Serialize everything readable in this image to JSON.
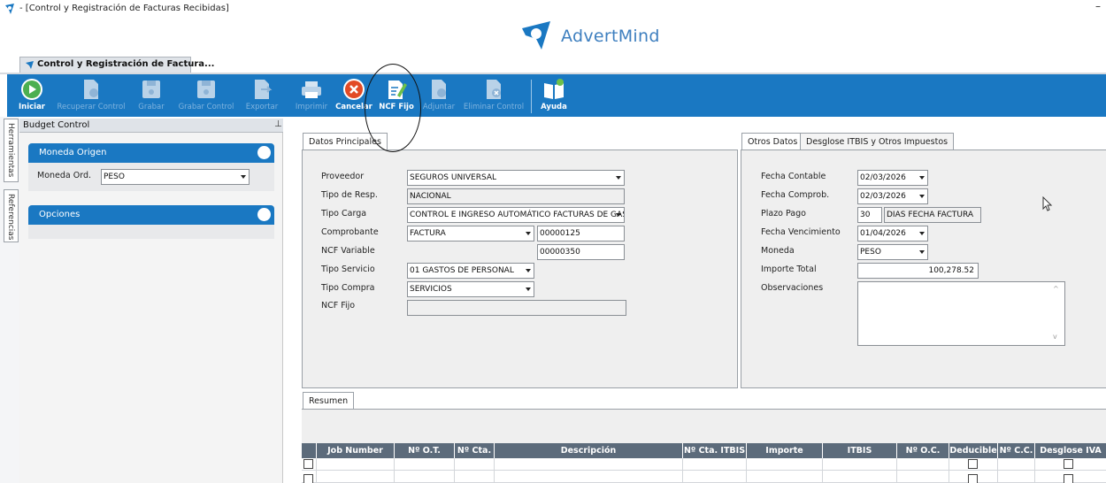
{
  "window": {
    "title": "- [Control y Registración de Facturas Recibidas]",
    "minimize_glyph": "–"
  },
  "brand": {
    "name": "AdvertMind",
    "color": "#3e7fbf"
  },
  "doc_tab": {
    "label": "Control y Registración de Factura..."
  },
  "toolbar": {
    "iniciar": "Iniciar",
    "recuperar": "Recuperar Control",
    "grabar": "Grabar",
    "grabar_control": "Grabar Control",
    "exportar": "Exportar",
    "imprimir": "Imprimir",
    "cancelar": "Cancelar",
    "ncf_fijo": "NCF Fijo",
    "adjuntar": "Adjuntar",
    "eliminar": "Eliminar Control",
    "ayuda": "Ayuda",
    "color": "#1a78c2"
  },
  "vertical_tabs": {
    "herramientas": "Herramientas",
    "referencias": "Referencias"
  },
  "budget": {
    "title": "Budget Control",
    "pin": "ᵖ",
    "moneda_origen": {
      "title": "Moneda Origen",
      "label": "Moneda Ord.",
      "value": "PESO"
    },
    "opciones": {
      "title": "Opciones"
    }
  },
  "datos_principales": {
    "tab": "Datos Principales",
    "proveedor": {
      "label": "Proveedor",
      "value": "SEGUROS UNIVERSAL"
    },
    "tipo_resp": {
      "label": "Tipo de Resp.",
      "value": "NACIONAL"
    },
    "tipo_carga": {
      "label": "Tipo Carga",
      "value": "CONTROL E INGRESO AUTOMÁTICO FACTURAS DE GAS"
    },
    "comprobante": {
      "label": "Comprobante",
      "value": "FACTURA",
      "number": "00000125"
    },
    "ncf_variable": {
      "label": "NCF Variable",
      "value": "00000350"
    },
    "tipo_servicio": {
      "label": "Tipo Servicio",
      "value": "01 GASTOS DE PERSONAL"
    },
    "tipo_compra": {
      "label": "Tipo Compra",
      "value": "SERVICIOS"
    },
    "ncf_fijo": {
      "label": "NCF Fijo",
      "value": ""
    }
  },
  "otros_datos": {
    "tab": "Otros Datos",
    "tab2": "Desglose ITBIS y Otros Impuestos",
    "fecha_contable": {
      "label": "Fecha Contable",
      "value": "02/03/2026"
    },
    "fecha_comprob": {
      "label": "Fecha Comprob.",
      "value": "02/03/2026"
    },
    "plazo_pago": {
      "label": "Plazo Pago",
      "value": "30",
      "unit": "DIAS FECHA FACTURA"
    },
    "fecha_vencimiento": {
      "label": "Fecha Vencimiento",
      "value": "01/04/2026"
    },
    "moneda": {
      "label": "Moneda",
      "value": "PESO"
    },
    "importe_total": {
      "label": "Importe Total",
      "value": "100,278.52"
    },
    "observaciones": {
      "label": "Observaciones",
      "value": ""
    }
  },
  "resumen": {
    "tab": "Resumen",
    "columns": [
      "Job Number",
      "Nº O.T.",
      "Nº Cta.",
      "Descripción",
      "Nº Cta. ITBIS",
      "Importe",
      "ITBIS",
      "Nº O.C.",
      "Deducible",
      "Nº C.C.",
      "Desglose IVA"
    ]
  }
}
